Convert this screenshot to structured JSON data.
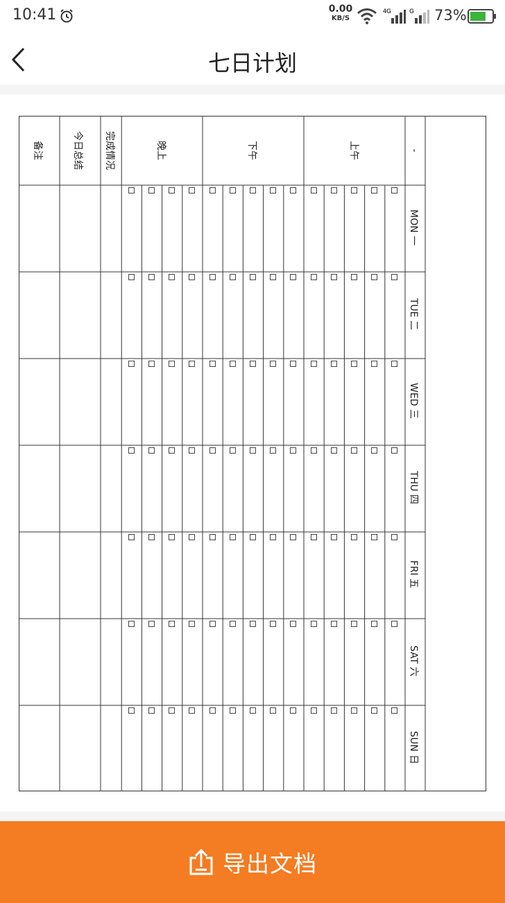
{
  "status_bar": {
    "time": "10:41",
    "net_speed_value": "0.00",
    "net_speed_unit": "KB/S",
    "sig1_label": "4G",
    "sig2_label": "G",
    "battery_percent": "73%",
    "battery_level": 0.73
  },
  "header": {
    "title": "七日计划"
  },
  "planner": {
    "corner_label": "-",
    "section_headers": {
      "morning": "上午",
      "afternoon": "下午",
      "evening": "晚上"
    },
    "row_labels": {
      "completion": "完成情况",
      "summary": "今日总结",
      "remarks": "备注"
    },
    "days": [
      "MON 一",
      "TUE 二",
      "WED 三",
      "THU 四",
      "FRI 五",
      "SAT 六",
      "SUN 日"
    ],
    "morning_slots": 5,
    "afternoon_slots": 5,
    "evening_slots": 4
  },
  "export": {
    "label": "导出文档"
  },
  "colors": {
    "accent": "#f47c22",
    "grid": "#333333",
    "separator": "#f4f4f4"
  }
}
